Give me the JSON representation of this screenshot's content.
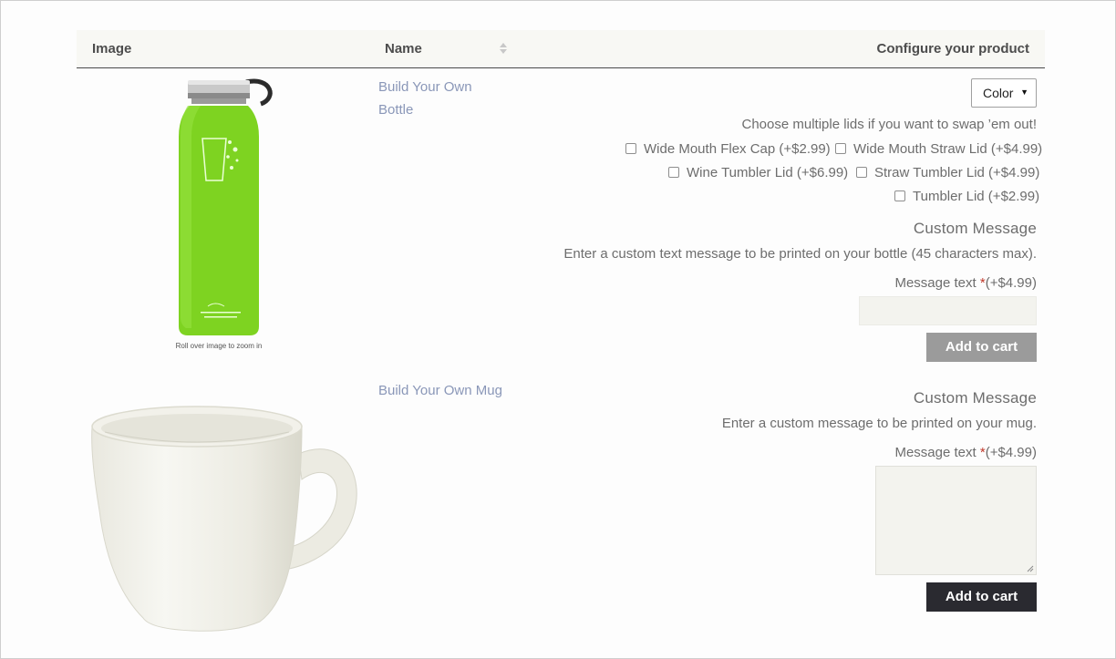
{
  "table": {
    "headers": {
      "image": "Image",
      "name": "Name",
      "configure": "Configure your product"
    }
  },
  "products": [
    {
      "name": "Build Your Own Bottle",
      "name_line1": "Build Your Own",
      "name_line2": "Bottle",
      "image_caption": "Roll over image to zoom in",
      "color_select": {
        "selected": "Color"
      },
      "lids_help": "Choose multiple lids if you want to swap ’em out!",
      "lids": [
        {
          "label": "Wide Mouth Flex Cap (+$2.99)",
          "checked": false
        },
        {
          "label": "Wide Mouth Straw Lid (+$4.99)",
          "checked": false
        },
        {
          "label": "Wine Tumbler Lid (+$6.99)",
          "checked": false
        },
        {
          "label": "Straw Tumbler Lid (+$4.99)",
          "checked": false
        },
        {
          "label": "Tumbler Lid (+$2.99)",
          "checked": false
        }
      ],
      "custom_title": "Custom Message",
      "custom_help": "Enter a custom text message to be printed on your bottle (45 characters max).",
      "field_label": "Message text",
      "required_mark": "*",
      "field_price": "(+$4.99)",
      "field_value": "",
      "add_to_cart": "Add to cart",
      "bottle_color": "#7ed321"
    },
    {
      "name": "Build Your Own Mug",
      "custom_title": "Custom Message",
      "custom_help": "Enter a custom message to be printed on your mug.",
      "field_label": "Message text",
      "required_mark": "*",
      "field_price": "(+$4.99)",
      "field_value": "",
      "add_to_cart": "Add to cart"
    }
  ]
}
